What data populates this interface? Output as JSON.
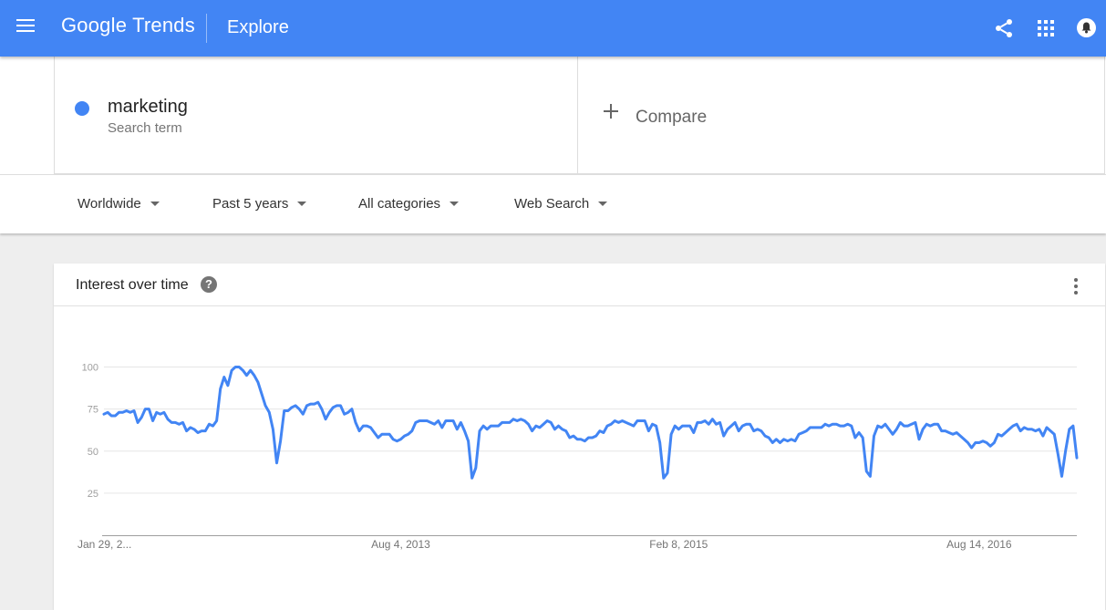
{
  "header": {
    "logo_google": "Google",
    "logo_trends": "Trends",
    "section": "Explore"
  },
  "search": {
    "term": "marketing",
    "term_type": "Search term",
    "term_color": "#4285f4",
    "compare_label": "Compare"
  },
  "filters": {
    "region": "Worldwide",
    "time": "Past 5 years",
    "category": "All categories",
    "search_type": "Web Search"
  },
  "card": {
    "title": "Interest over time",
    "help_glyph": "?"
  },
  "icons": [
    "menu-icon",
    "share-icon",
    "apps-icon",
    "notifications-icon",
    "help-icon",
    "more-vert-icon",
    "plus-icon"
  ],
  "chart_data": {
    "type": "line",
    "title": "Interest over time",
    "yticks": [
      25,
      50,
      75,
      100
    ],
    "ylim": [
      0,
      100
    ],
    "x_ticks": [
      {
        "label": "Jan 29, 2...",
        "index": 0
      },
      {
        "label": "Aug 4, 2013",
        "index": 79
      },
      {
        "label": "Feb 8, 2015",
        "index": 153
      },
      {
        "label": "Aug 14, 2016",
        "index": 233
      }
    ],
    "grid": true,
    "series": [
      {
        "name": "marketing",
        "color": "#4285f4",
        "values": [
          72,
          73,
          71,
          71,
          73,
          73,
          74,
          73,
          74,
          67,
          70,
          75,
          75,
          68,
          73,
          72,
          73,
          69,
          67,
          67,
          66,
          67,
          62,
          64,
          63,
          61,
          62,
          62,
          66,
          65,
          68,
          87,
          94,
          89,
          98,
          100,
          100,
          98,
          95,
          98,
          95,
          91,
          84,
          77,
          73,
          63,
          43,
          56,
          74,
          74,
          76,
          77,
          75,
          72,
          77,
          78,
          78,
          79,
          75,
          69,
          73,
          76,
          77,
          77,
          72,
          73,
          75,
          67,
          62,
          65,
          65,
          64,
          61,
          58,
          60,
          60,
          60,
          57,
          56,
          57,
          59,
          60,
          62,
          67,
          68,
          68,
          68,
          67,
          66,
          68,
          64,
          68,
          68,
          68,
          63,
          67,
          62,
          56,
          34,
          40,
          62,
          65,
          63,
          65,
          65,
          65,
          67,
          67,
          67,
          69,
          68,
          69,
          68,
          66,
          62,
          65,
          64,
          66,
          68,
          67,
          63,
          65,
          63,
          62,
          58,
          59,
          57,
          57,
          56,
          58,
          58,
          59,
          62,
          61,
          65,
          66,
          68,
          67,
          68,
          67,
          66,
          65,
          68,
          68,
          68,
          62,
          66,
          65,
          55,
          34,
          37,
          60,
          65,
          63,
          65,
          65,
          65,
          61,
          67,
          67,
          68,
          66,
          69,
          66,
          67,
          59,
          63,
          65,
          67,
          62,
          65,
          66,
          66,
          62,
          63,
          62,
          59,
          58,
          55,
          57,
          55,
          57,
          56,
          57,
          56,
          60,
          61,
          62,
          64,
          64,
          64,
          64,
          66,
          65,
          66,
          66,
          65,
          65,
          66,
          65,
          58,
          61,
          58,
          38,
          35,
          59,
          65,
          64,
          66,
          63,
          60,
          63,
          67,
          65,
          65,
          66,
          67,
          57,
          63,
          66,
          65,
          66,
          66,
          62,
          62,
          61,
          60,
          61,
          59,
          57,
          55,
          52,
          55,
          55,
          56,
          55,
          53,
          55,
          60,
          59,
          61,
          63,
          65,
          66,
          62,
          64,
          63,
          63,
          62,
          63,
          59,
          64,
          62,
          60,
          48,
          35,
          50,
          63,
          65,
          46
        ]
      }
    ]
  }
}
